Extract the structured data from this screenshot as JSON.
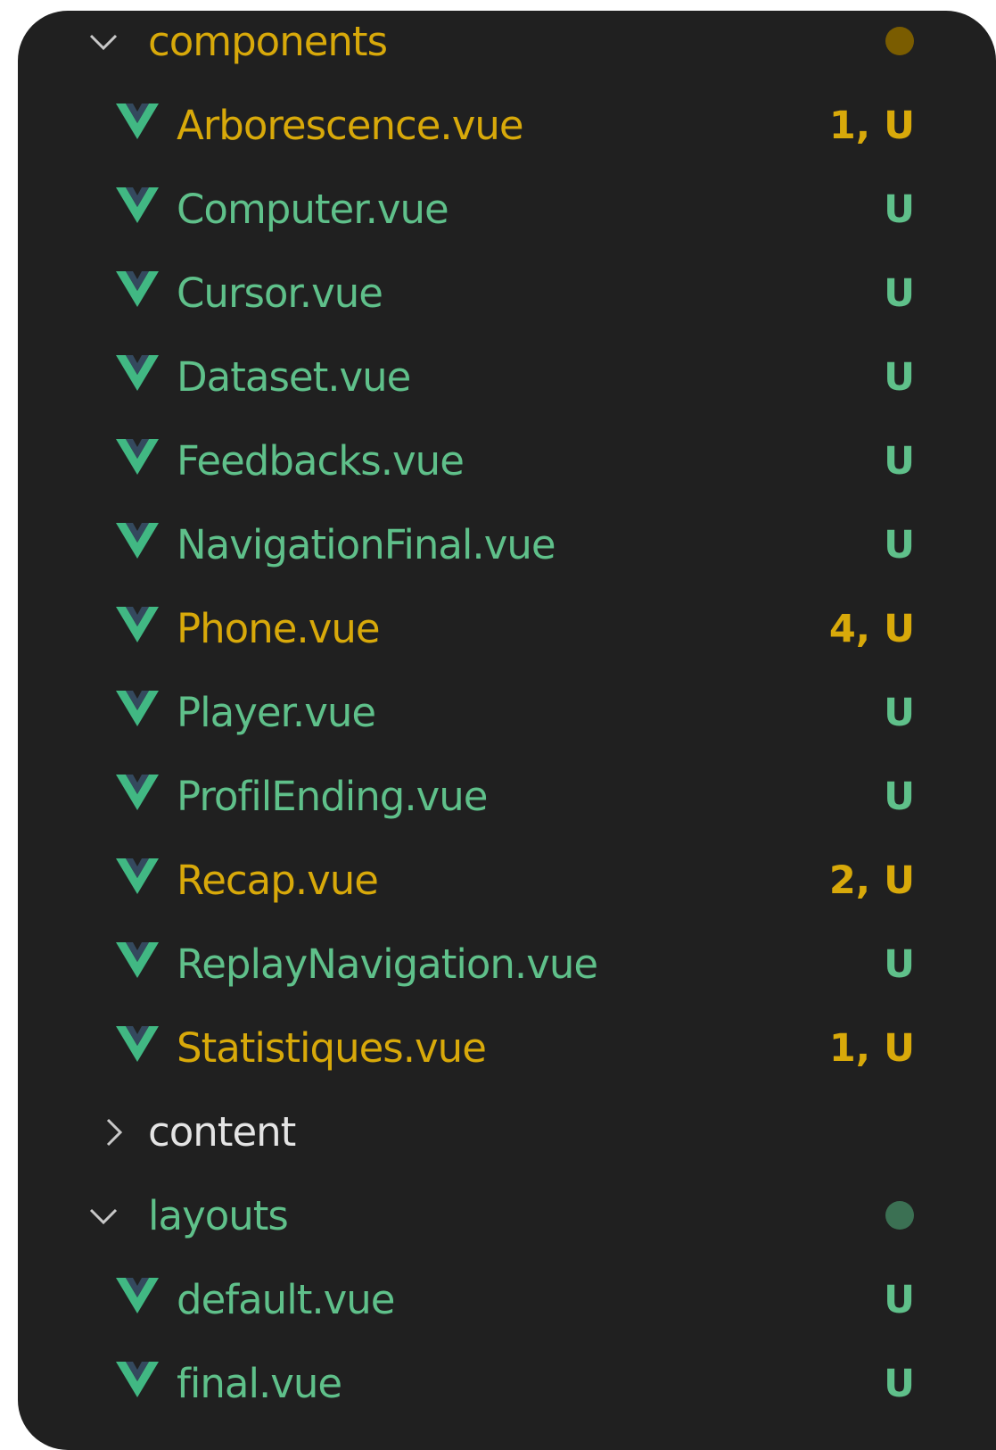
{
  "colors": {
    "modified": "#d8a90a",
    "untracked": "#5fc08a",
    "default_text": "#e4e4e4",
    "vue_logo_outer": "#41b883",
    "vue_logo_inner": "#34495e",
    "folder_dot_modified": "#7a5c00",
    "folder_dot_untracked": "#3b7053",
    "background": "#202020"
  },
  "explorer": {
    "components": {
      "label": "components",
      "expanded": true,
      "status": "modified",
      "dot": true,
      "files": [
        {
          "name": "Arborescence.vue",
          "badge": "1, U",
          "status": "modified",
          "icon": "vue-icon"
        },
        {
          "name": "Computer.vue",
          "badge": "U",
          "status": "untracked",
          "icon": "vue-icon"
        },
        {
          "name": "Cursor.vue",
          "badge": "U",
          "status": "untracked",
          "icon": "vue-icon"
        },
        {
          "name": "Dataset.vue",
          "badge": "U",
          "status": "untracked",
          "icon": "vue-icon"
        },
        {
          "name": "Feedbacks.vue",
          "badge": "U",
          "status": "untracked",
          "icon": "vue-icon"
        },
        {
          "name": "NavigationFinal.vue",
          "badge": "U",
          "status": "untracked",
          "icon": "vue-icon"
        },
        {
          "name": "Phone.vue",
          "badge": "4, U",
          "status": "modified",
          "icon": "vue-icon"
        },
        {
          "name": "Player.vue",
          "badge": "U",
          "status": "untracked",
          "icon": "vue-icon"
        },
        {
          "name": "ProfilEnding.vue",
          "badge": "U",
          "status": "untracked",
          "icon": "vue-icon"
        },
        {
          "name": "Recap.vue",
          "badge": "2, U",
          "status": "modified",
          "icon": "vue-icon"
        },
        {
          "name": "ReplayNavigation.vue",
          "badge": "U",
          "status": "untracked",
          "icon": "vue-icon"
        },
        {
          "name": "Statistiques.vue",
          "badge": "1, U",
          "status": "modified",
          "icon": "vue-icon"
        }
      ]
    },
    "content": {
      "label": "content",
      "expanded": false,
      "status": "none",
      "dot": false
    },
    "layouts": {
      "label": "layouts",
      "expanded": true,
      "status": "untracked",
      "dot": true,
      "files": [
        {
          "name": "default.vue",
          "badge": "U",
          "status": "untracked",
          "icon": "vue-icon"
        },
        {
          "name": "final.vue",
          "badge": "U",
          "status": "untracked",
          "icon": "vue-icon"
        }
      ]
    }
  }
}
